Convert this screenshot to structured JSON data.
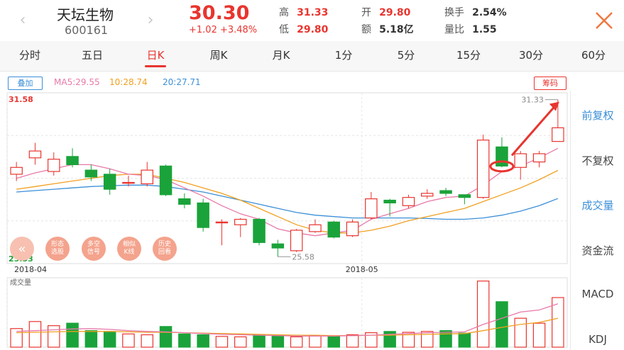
{
  "header": {
    "name": "天坛生物",
    "code": "600161",
    "price": "30.30",
    "change": "+1.02  +3.48%",
    "quotes": [
      {
        "label": "高",
        "value": "31.33",
        "color": "#e8352f"
      },
      {
        "label": "低",
        "value": "29.80",
        "color": "#e8352f"
      },
      {
        "label": "开",
        "value": "29.80",
        "color": "#e8352f"
      },
      {
        "label": "额",
        "value": "5.18亿",
        "color": "#333333"
      },
      {
        "label": "换手",
        "value": "2.54%",
        "color": "#333333"
      },
      {
        "label": "量比",
        "value": "1.55",
        "color": "#333333"
      }
    ],
    "prev_arrow": "‹",
    "next_arrow": "›"
  },
  "tabs": [
    {
      "label": "分时"
    },
    {
      "label": "五日"
    },
    {
      "label": "日K"
    },
    {
      "label": "周K"
    },
    {
      "label": "月K"
    },
    {
      "label": "1分"
    },
    {
      "label": "5分"
    },
    {
      "label": "15分"
    },
    {
      "label": "30分"
    },
    {
      "label": "60分"
    }
  ],
  "active_tab": 2,
  "ma": {
    "overlay_label": "叠加",
    "chip_label": "筹码",
    "ma5": "MA5:29.55",
    "ma10": "10:28.74",
    "ma20": "20:27.71",
    "colors": {
      "ma5": "#e879a8",
      "ma10": "#f0a020",
      "ma20": "#3b8fd8"
    }
  },
  "side": [
    {
      "label": "前复权",
      "active": true
    },
    {
      "label": "不复权",
      "active": false
    },
    {
      "label": "成交量",
      "active": true
    },
    {
      "label": "资金流",
      "active": false
    },
    {
      "label": "MACD",
      "active": false
    },
    {
      "label": "KDJ",
      "active": false
    }
  ],
  "tools": [
    {
      "label": "形态\n选股"
    },
    {
      "label": "多空\n信号"
    },
    {
      "label": "相似\nK线"
    },
    {
      "label": "历史\n回看"
    }
  ],
  "chart_data": {
    "type": "candlestick",
    "price_axis": {
      "max": 31.58,
      "min": 25.33,
      "max_label": "31.58",
      "min_label": "25.33"
    },
    "x_labels": [
      {
        "index": 0,
        "label": "2018-04"
      },
      {
        "index": 19,
        "label": "2018-05"
      }
    ],
    "annotations": {
      "high": "31.33",
      "low": "25.58"
    },
    "volume_label": "成交量",
    "candles": [
      {
        "o": 28.6,
        "c": 28.85,
        "h": 29.05,
        "l": 28.35
      },
      {
        "o": 29.2,
        "c": 29.45,
        "h": 29.75,
        "l": 28.95
      },
      {
        "o": 28.7,
        "c": 29.15,
        "h": 29.4,
        "l": 28.55
      },
      {
        "o": 29.25,
        "c": 28.95,
        "h": 29.55,
        "l": 28.85
      },
      {
        "o": 28.75,
        "c": 28.5,
        "h": 28.95,
        "l": 28.35
      },
      {
        "o": 28.6,
        "c": 28.05,
        "h": 28.8,
        "l": 27.85
      },
      {
        "o": 28.3,
        "c": 28.3,
        "h": 28.55,
        "l": 28.15
      },
      {
        "o": 28.25,
        "c": 28.75,
        "h": 29.05,
        "l": 28.15
      },
      {
        "o": 28.9,
        "c": 27.85,
        "h": 28.95,
        "l": 27.8
      },
      {
        "o": 27.7,
        "c": 27.5,
        "h": 27.9,
        "l": 27.35
      },
      {
        "o": 27.55,
        "c": 26.65,
        "h": 27.7,
        "l": 26.5
      },
      {
        "o": 26.85,
        "c": 26.85,
        "h": 26.95,
        "l": 26.0
      },
      {
        "o": 26.75,
        "c": 26.95,
        "h": 27.0,
        "l": 26.3
      },
      {
        "o": 26.95,
        "c": 26.1,
        "h": 27.0,
        "l": 26.0
      },
      {
        "o": 26.05,
        "c": 25.9,
        "h": 26.2,
        "l": 25.58
      },
      {
        "o": 25.8,
        "c": 26.55,
        "h": 26.6,
        "l": 25.75
      },
      {
        "o": 26.5,
        "c": 26.75,
        "h": 26.95,
        "l": 26.45
      },
      {
        "o": 26.85,
        "c": 26.3,
        "h": 26.9,
        "l": 26.25
      },
      {
        "o": 26.35,
        "c": 26.85,
        "h": 26.95,
        "l": 26.3
      },
      {
        "o": 27.0,
        "c": 27.7,
        "h": 27.95,
        "l": 26.95
      },
      {
        "o": 27.65,
        "c": 27.55,
        "h": 27.7,
        "l": 27.05
      },
      {
        "o": 27.45,
        "c": 27.75,
        "h": 27.85,
        "l": 27.35
      },
      {
        "o": 27.8,
        "c": 27.9,
        "h": 28.05,
        "l": 27.7
      },
      {
        "o": 28.0,
        "c": 27.9,
        "h": 28.1,
        "l": 27.8
      },
      {
        "o": 27.85,
        "c": 27.75,
        "h": 27.85,
        "l": 27.5
      },
      {
        "o": 27.75,
        "c": 29.85,
        "h": 30.05,
        "l": 27.7
      },
      {
        "o": 29.6,
        "c": 28.9,
        "h": 29.95,
        "l": 28.85
      },
      {
        "o": 28.85,
        "c": 29.35,
        "h": 29.45,
        "l": 28.4
      },
      {
        "o": 29.05,
        "c": 29.35,
        "h": 29.45,
        "l": 28.85
      },
      {
        "o": 29.8,
        "c": 30.3,
        "h": 31.33,
        "l": 29.8
      }
    ],
    "volumes": [
      45,
      62,
      52,
      58,
      40,
      38,
      32,
      30,
      50,
      32,
      30,
      26,
      25,
      30,
      28,
      25,
      28,
      26,
      30,
      35,
      38,
      36,
      38,
      40,
      34,
      160,
      110,
      70,
      58,
      120
    ],
    "ma5": [
      28.45,
      28.65,
      28.8,
      28.95,
      28.95,
      28.8,
      28.6,
      28.55,
      28.4,
      28.1,
      27.8,
      27.45,
      27.15,
      26.95,
      26.6,
      26.45,
      26.35,
      26.45,
      26.55,
      26.95,
      27.15,
      27.35,
      27.6,
      27.75,
      27.8,
      28.2,
      28.7,
      28.9,
      29.2,
      29.55
    ],
    "ma10": [
      28.05,
      28.15,
      28.25,
      28.35,
      28.45,
      28.55,
      28.6,
      28.6,
      28.45,
      28.3,
      28.1,
      27.9,
      27.65,
      27.35,
      27.05,
      26.75,
      26.55,
      26.45,
      26.45,
      26.55,
      26.7,
      26.9,
      27.05,
      27.2,
      27.35,
      27.6,
      27.85,
      28.1,
      28.4,
      28.74
    ],
    "ma20": [
      27.95,
      28.0,
      28.05,
      28.1,
      28.15,
      28.18,
      28.2,
      28.2,
      28.15,
      28.05,
      27.95,
      27.8,
      27.65,
      27.5,
      27.35,
      27.2,
      27.1,
      27.05,
      27.0,
      27.0,
      27.0,
      27.0,
      26.98,
      26.95,
      26.95,
      27.0,
      27.1,
      27.25,
      27.45,
      27.71
    ],
    "vol_ma": [
      38,
      40,
      42,
      44,
      45,
      43,
      40,
      38,
      37,
      35,
      33,
      31,
      30,
      29,
      28,
      27,
      27,
      27,
      28,
      29,
      31,
      33,
      35,
      36,
      37,
      55,
      70,
      85,
      90,
      105
    ],
    "vol_ma2": [
      35,
      36,
      37,
      38,
      38,
      38,
      37,
      36,
      36,
      35,
      34,
      33,
      32,
      31,
      30,
      29,
      29,
      28,
      28,
      29,
      29,
      30,
      31,
      32,
      33,
      40,
      48,
      55,
      60,
      70
    ]
  }
}
